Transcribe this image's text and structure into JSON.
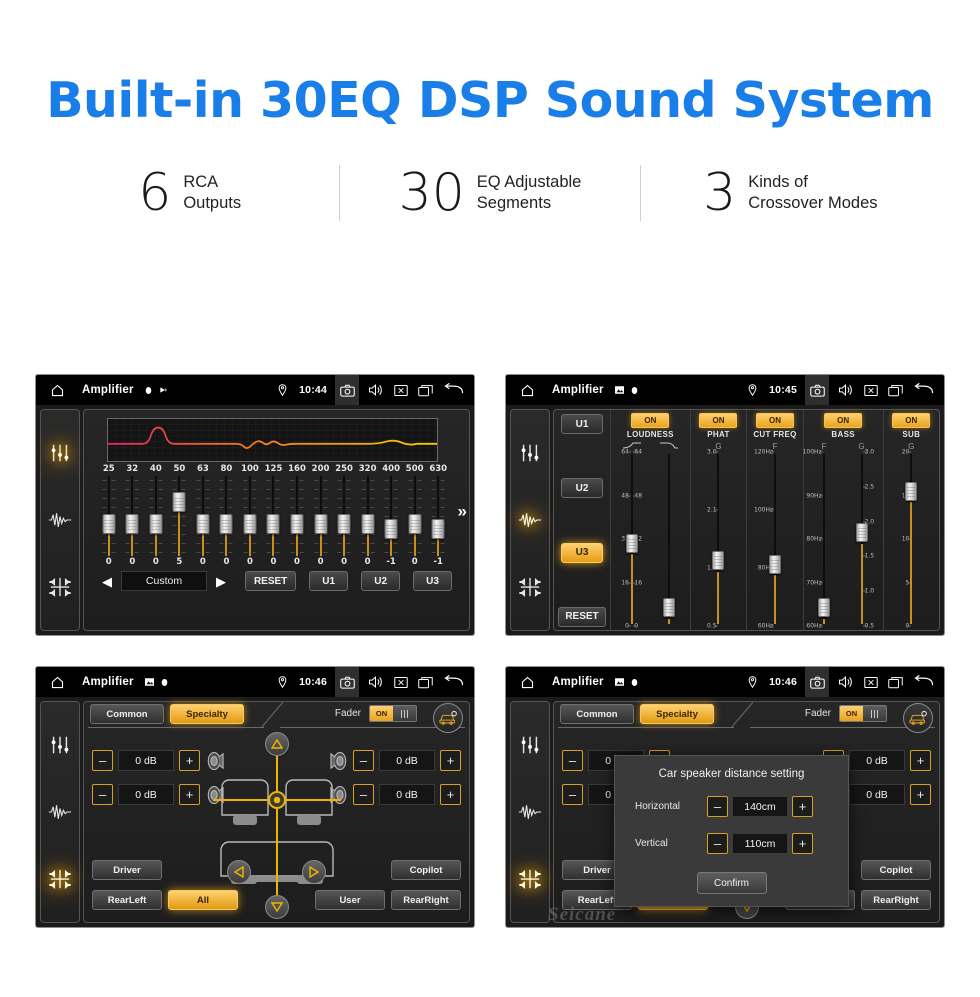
{
  "header": {
    "title": "Built-in 30EQ DSP Sound System",
    "accent_color": "#1a7ee8",
    "stats": [
      {
        "number": "6",
        "line1": "RCA",
        "line2": "Outputs"
      },
      {
        "number": "30",
        "line1": "EQ Adjustable",
        "line2": "Segments"
      },
      {
        "number": "3",
        "line1": "Kinds of",
        "line2": "Crossover Modes"
      }
    ]
  },
  "statusbar": {
    "app_title": "Amplifier",
    "icons": [
      "home-icon",
      "location-icon",
      "camera-icon",
      "volume-icon",
      "close-box-icon",
      "recents-icon",
      "back-icon"
    ],
    "times": {
      "p1": "10:44",
      "p2": "10:45",
      "p3": "10:46",
      "p4": "10:46"
    }
  },
  "rail": {
    "items": [
      "equalizer-icon",
      "waveform-icon",
      "balance-icon"
    ]
  },
  "panel_eq": {
    "graph_color_start": "#e8206a",
    "graph_color_mid": "#ef7b1e",
    "graph_color_end": "#f2d000",
    "preset": "Custom",
    "reset_label": "RESET",
    "user_buttons": [
      "U1",
      "U2",
      "U3"
    ],
    "prev_label": "◀",
    "next_label": "▶",
    "more_label": "»",
    "bands": [
      {
        "freq": "25",
        "value": "0"
      },
      {
        "freq": "32",
        "value": "0"
      },
      {
        "freq": "40",
        "value": "0"
      },
      {
        "freq": "50",
        "value": "5"
      },
      {
        "freq": "63",
        "value": "0"
      },
      {
        "freq": "80",
        "value": "0"
      },
      {
        "freq": "100",
        "value": "0"
      },
      {
        "freq": "125",
        "value": "0"
      },
      {
        "freq": "160",
        "value": "0"
      },
      {
        "freq": "200",
        "value": "0"
      },
      {
        "freq": "250",
        "value": "0"
      },
      {
        "freq": "320",
        "value": "0"
      },
      {
        "freq": "400",
        "value": "-1"
      },
      {
        "freq": "500",
        "value": "0"
      },
      {
        "freq": "630",
        "value": "-1"
      }
    ]
  },
  "panel_xover": {
    "presets": [
      "U1",
      "U2",
      "U3"
    ],
    "selected_preset": "U3",
    "reset_label": "RESET",
    "on_label": "ON",
    "sections": [
      {
        "name": "LOUDNESS",
        "on": "ON",
        "sliders": [
          {
            "header": "curve-low-icon",
            "labels_left": [
              "64",
              "48",
              "32",
              "16",
              "0"
            ],
            "labels_right": [
              "64",
              "48",
              "32",
              "16",
              "0"
            ],
            "knob_pct": 42
          },
          {
            "header": "curve-high-icon",
            "labels_left": [],
            "labels_right": [],
            "knob_pct": 5
          }
        ]
      },
      {
        "name": "PHAT",
        "on": "ON",
        "sliders": [
          {
            "header": "G",
            "labels_left": [
              "3.0",
              "2.1",
              "1.3",
              "0.5"
            ],
            "labels_right": [],
            "knob_pct": 32
          }
        ]
      },
      {
        "name": "CUT FREQ",
        "on": "ON",
        "sliders": [
          {
            "header": "F",
            "labels_left": [
              "120Hz",
              "100Hz",
              "80Hz",
              "60Hz"
            ],
            "labels_right": [],
            "knob_pct": 30
          }
        ]
      },
      {
        "name": "BASS",
        "on": "ON",
        "sliders": [
          {
            "header": "F",
            "labels_left": [
              "100Hz",
              "90Hz",
              "80Hz",
              "70Hz",
              "60Hz"
            ],
            "labels_right": [],
            "knob_pct": 5
          },
          {
            "header": "G",
            "labels_left": [],
            "labels_right": [
              "3.0",
              "2.5",
              "2.0",
              "1.5",
              "1.0",
              "0.5"
            ],
            "knob_pct": 48
          }
        ]
      },
      {
        "name": "SUB",
        "on": "ON",
        "sliders": [
          {
            "header": "G",
            "labels_left": [
              "20",
              "15",
              "10",
              "5",
              "0"
            ],
            "labels_right": [],
            "knob_pct": 72
          }
        ]
      }
    ]
  },
  "panel_fader": {
    "tabs": [
      {
        "label": "Common",
        "selected": false
      },
      {
        "label": "Specialty",
        "selected": true
      }
    ],
    "fader_label": "Fader",
    "fader_toggle": "ON",
    "car_settings_icon": "car-settings-icon",
    "levels": [
      {
        "position": "front-left",
        "value": "0 dB",
        "minus": "–",
        "plus": "+"
      },
      {
        "position": "rear-left",
        "value": "0 dB",
        "minus": "–",
        "plus": "+"
      },
      {
        "position": "front-right",
        "value": "0 dB",
        "minus": "–",
        "plus": "+"
      },
      {
        "position": "rear-right",
        "value": "0 dB",
        "minus": "–",
        "plus": "+"
      }
    ],
    "seat_buttons": [
      {
        "label": "Driver",
        "selected": false
      },
      {
        "label": "Copilot",
        "selected": false
      },
      {
        "label": "RearLeft",
        "selected": false
      },
      {
        "label": "All",
        "selected": true
      },
      {
        "label": "User",
        "selected": false
      },
      {
        "label": "RearRight",
        "selected": false
      }
    ],
    "nav_up": "△",
    "nav_down": "▽",
    "nav_left": "◁",
    "nav_right": "▷"
  },
  "panel_dialog": {
    "title": "Car speaker distance setting",
    "rows": [
      {
        "label": "Horizontal",
        "value": "140cm",
        "minus": "–",
        "plus": "+"
      },
      {
        "label": "Vertical",
        "value": "110cm",
        "minus": "–",
        "plus": "+"
      }
    ],
    "confirm_label": "Confirm"
  },
  "watermark": {
    "text": "Seicane"
  }
}
